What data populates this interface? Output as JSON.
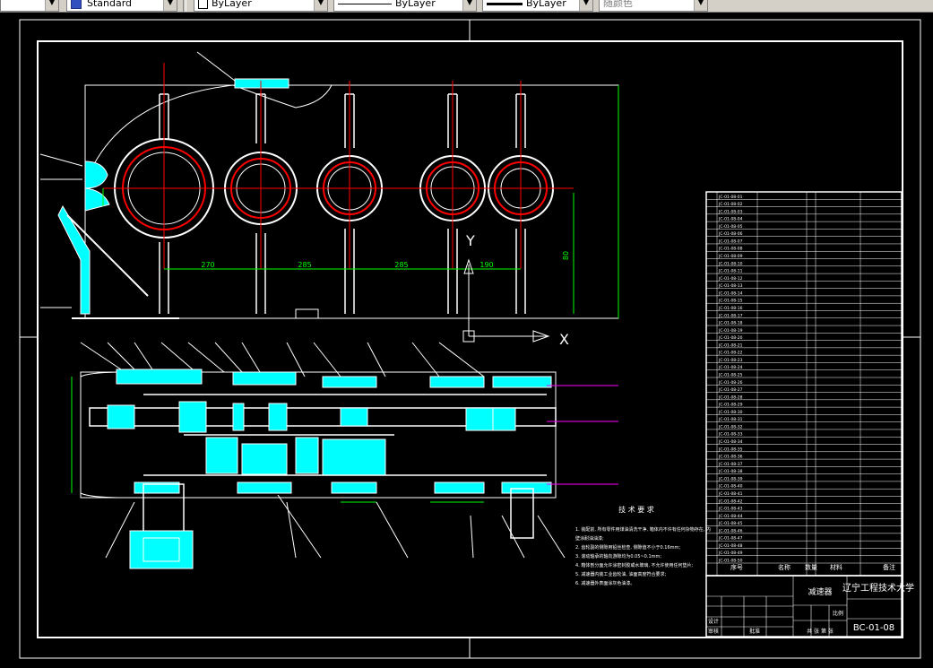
{
  "toolbar": {
    "dimstyle": {
      "value": "Standard",
      "icon": "dimstyle-icon"
    },
    "layer": {
      "value": "ByLayer"
    },
    "linetype": {
      "value": "ByLayer"
    },
    "lineweight": {
      "value": "ByLayer"
    },
    "color": {
      "value": "随颜色"
    }
  },
  "colors": {
    "background": "#000000",
    "border": "#ffffff",
    "dimension": "#00ff00",
    "section": "#00ffff",
    "center": "#ff0000",
    "text": "#ffffff"
  },
  "drawing": {
    "dims_top": [
      "270",
      "285",
      "285",
      "190"
    ],
    "dim_height": "80",
    "ucs": {
      "x_label": "X",
      "y_label": "Y"
    },
    "tech_req": {
      "title": "技 术 要 求",
      "lines": [
        "1. 装配前, 所有零件用煤油清洗干净, 箱体内不许有任何杂物存在, 内",
        "   壁涂耐油油漆;",
        "2. 齿轮副的侧隙用铅丝检查, 侧隙值不小于0.16mm;",
        "3. 滚动轴承的轴向游隙均为0.05~0.1mm;",
        "4. 箱体剖分面允许涂密封胶或水玻璃, 不允许使用任何垫片;",
        "5. 减速器内装工业齿轮油, 油面高度符合要求;",
        "6. 减速器外表面涂灰色油漆。"
      ]
    },
    "bom_headers": {
      "seq": "序号",
      "name": "名称",
      "qty": "数量",
      "material": "材料",
      "remark": "备注"
    },
    "bom_rows": [
      "JC-01-08-01",
      "JC-01-08-02",
      "JC-01-08-03",
      "JC-01-08-04",
      "JC-01-08-05",
      "JC-01-08-06",
      "JC-01-08-07",
      "JC-01-08-08",
      "JC-01-08-09",
      "JC-01-08-10",
      "JC-01-08-11",
      "JC-01-08-12",
      "JC-01-08-13",
      "JC-01-08-14",
      "JC-01-08-15",
      "JC-01-08-16",
      "JC-01-08-17",
      "JC-01-08-18",
      "JC-01-08-19",
      "JC-01-08-20",
      "JC-01-08-21",
      "JC-01-08-22",
      "JC-01-08-23",
      "JC-01-08-24",
      "JC-01-08-25",
      "JC-01-08-26",
      "JC-01-08-27",
      "JC-01-08-28",
      "JC-01-08-29",
      "JC-01-08-30",
      "JC-01-08-31",
      "JC-01-08-32",
      "JC-01-08-33",
      "JC-01-08-34",
      "JC-01-08-35",
      "JC-01-08-36",
      "JC-01-08-37",
      "JC-01-08-38",
      "JC-01-08-39",
      "JC-01-08-40",
      "JC-01-08-41",
      "JC-01-08-42",
      "JC-01-08-43",
      "JC-01-08-44",
      "JC-01-08-45",
      "JC-01-08-46",
      "JC-01-08-47",
      "JC-01-08-48",
      "JC-01-08-49",
      "JC-01-08-50"
    ],
    "title_block": {
      "school": "辽宁工程技术大学",
      "name": "减速器",
      "code": "BC-01-08",
      "design": "设计",
      "check": "审核",
      "approve": "批准",
      "scale": "比例",
      "sheet": "共 张 第 张"
    }
  }
}
